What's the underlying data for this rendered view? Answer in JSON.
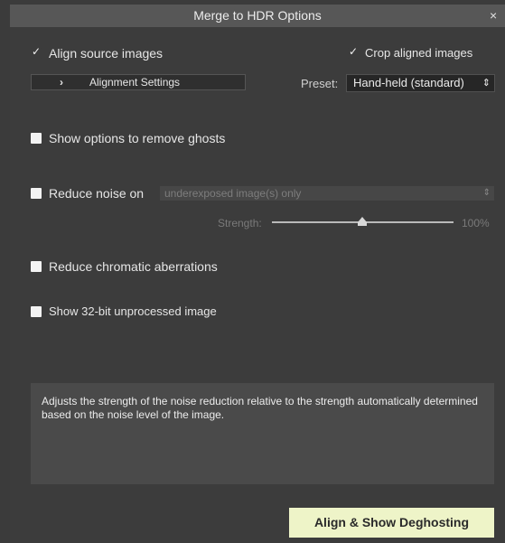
{
  "dialog": {
    "title": "Merge to HDR Options",
    "close_glyph": "×"
  },
  "align_source": {
    "label": "Align source images",
    "checked": true
  },
  "crop_aligned": {
    "label": "Crop aligned images",
    "checked": true
  },
  "alignment_settings": {
    "chevron": "›",
    "label": "Alignment Settings"
  },
  "preset": {
    "label": "Preset:",
    "value": "Hand-held (standard)",
    "arrows": "⇕"
  },
  "ghosts": {
    "label": "Show options to remove ghosts",
    "checked": false
  },
  "reduce_noise": {
    "label": "Reduce noise on",
    "checked": false,
    "dropdown_value": "underexposed image(s) only",
    "dropdown_arrows": "⇕",
    "strength_label": "Strength:",
    "strength_value": "100%",
    "strength_fraction": 0.5
  },
  "chromatic": {
    "label": "Reduce chromatic aberrations",
    "checked": false
  },
  "show32": {
    "label": "Show 32-bit unprocessed image",
    "checked": false
  },
  "help_text": "Adjusts the strength of the noise reduction relative to the strength automatically determined based on the noise level of the image.",
  "primary_button": "Align & Show Deghosting",
  "colors": {
    "background": "#3c3c3c",
    "titlebar": "#575757",
    "primary_button_bg": "#eef4c8",
    "help_box_bg": "#4a4a4a"
  }
}
